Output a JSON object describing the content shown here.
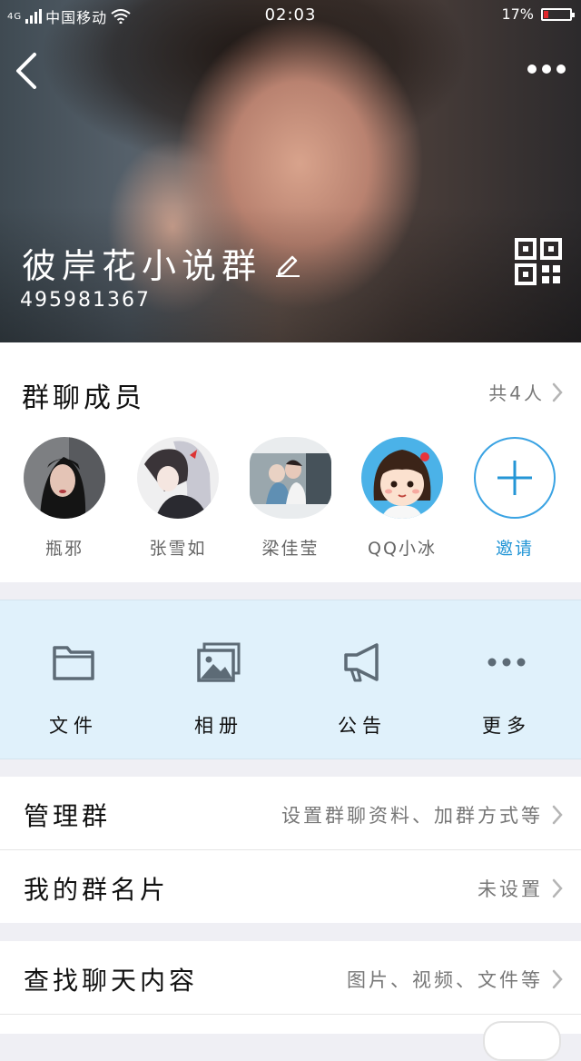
{
  "status_bar": {
    "network": "4G",
    "carrier": "中国移动",
    "time": "02:03",
    "battery_percent": "17%",
    "battery_level": 0.17,
    "battery_color": "#e0262a"
  },
  "header": {
    "group_name": "彼岸花小说群",
    "group_id": "495981367"
  },
  "members": {
    "title": "群聊成员",
    "count_label": "共4人",
    "list": [
      {
        "name": "瓶邪"
      },
      {
        "name": "张雪如"
      },
      {
        "name": "梁佳莹"
      },
      {
        "name": "QQ小冰"
      }
    ],
    "invite_label": "邀请"
  },
  "tools": {
    "files": "文件",
    "album": "相册",
    "notice": "公告",
    "more": "更多"
  },
  "rows": {
    "manage": {
      "title": "管理群",
      "value": "设置群聊资料、加群方式等"
    },
    "card": {
      "title": "我的群名片",
      "value": "未设置"
    },
    "search": {
      "title": "查找聊天内容",
      "value": "图片、视频、文件等"
    }
  },
  "colors": {
    "accent": "#2496d6",
    "tools_bg": "#e0f1fb",
    "icon_gray": "#5d6b76"
  }
}
